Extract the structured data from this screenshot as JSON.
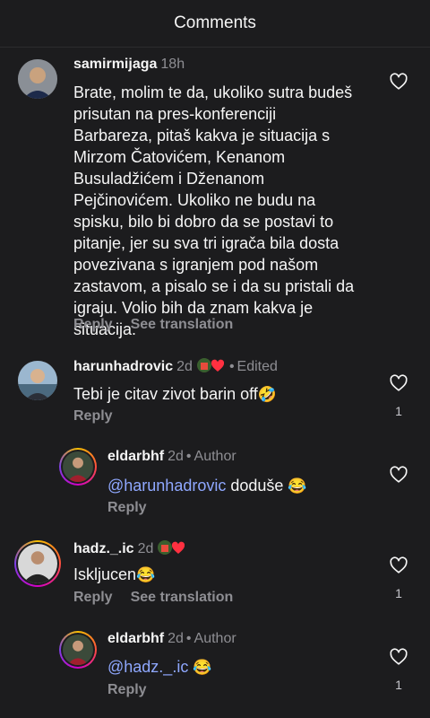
{
  "header": {
    "title": "Comments"
  },
  "comments": [
    {
      "username": "samirmijaga",
      "time": "18h",
      "text": "Brate, molim te da, ukoliko sutra budeš prisutan na pres-konferenciji Barbareza, pitaš kakva je situacija s Mirzom Čatovićem, Kenanom Busuladžićem i Dženanom Pejčinovićem. Ukoliko ne budu na spisku, bilo bi dobro da se postavi to pitanje, jer su sva tri igrača bila dosta povezivana s igranjem pod našom zastavom, a pisalo se i da su pristali da igraju. Volio bih da znam kakva je situacija.",
      "reply_label": "Reply",
      "translate_label": "See translation",
      "likes": ""
    },
    {
      "username": "harunhadrovic",
      "time": "2d",
      "edited_label": "Edited",
      "text": "Tebi je citav zivot barin off",
      "emoji": "🤣",
      "reply_label": "Reply",
      "likes": "1"
    },
    {
      "username": "eldarbhf",
      "time": "2d",
      "author_label": "Author",
      "mention": "@harunhadrovic",
      "text": " doduše ",
      "emoji": "😂",
      "reply_label": "Reply",
      "likes": ""
    },
    {
      "username": "hadz._.ic",
      "time": "2d",
      "text": "Iskljucen",
      "emoji": "😂",
      "reply_label": "Reply",
      "translate_label": "See translation",
      "likes": "1"
    },
    {
      "username": "eldarbhf",
      "time": "2d",
      "author_label": "Author",
      "mention": "@hadz._.ic",
      "text": " ",
      "emoji": "😂",
      "reply_label": "Reply",
      "likes": "1"
    }
  ],
  "colors": {
    "background": "#1c1c1e",
    "secondary_text": "#8e8e93",
    "mention": "#8fa8ff",
    "badge_heart": "#ff3040"
  },
  "icons": {
    "like": "heart-outline-icon",
    "badge": "jersey-heart-badge-icon"
  }
}
